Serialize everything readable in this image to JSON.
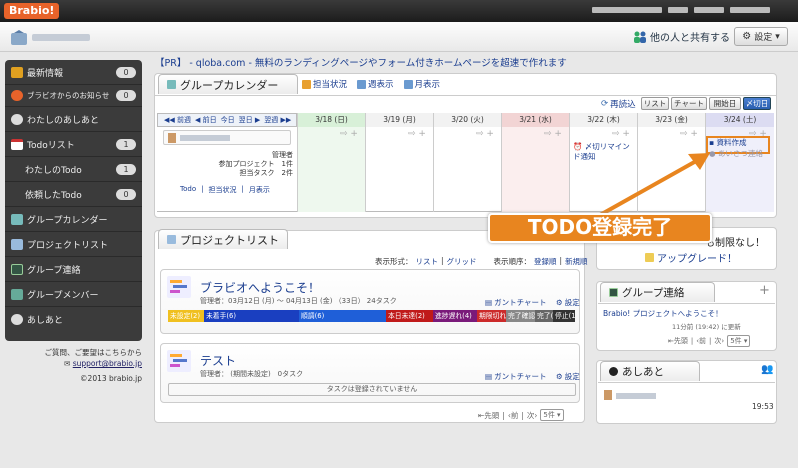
{
  "app": {
    "logo": "Brabio!"
  },
  "header": {
    "share_label": "他の人と共有する",
    "settings_label": "設定"
  },
  "sidebar": {
    "items": [
      {
        "label": "最新情報",
        "count": "0"
      },
      {
        "label": "ブラビオからのお知らせ",
        "count": "0"
      },
      {
        "label": "わたしのあしあと"
      },
      {
        "label": "Todoリスト",
        "count": "1"
      },
      {
        "label": "わたしのTodo",
        "count": "1"
      },
      {
        "label": "依頼したTodo",
        "count": "0"
      },
      {
        "label": "グループカレンダー"
      },
      {
        "label": "プロジェクトリスト"
      },
      {
        "label": "グループ連絡"
      },
      {
        "label": "グループメンバー"
      },
      {
        "label": "あしあと"
      }
    ],
    "footer": {
      "line1": "ご質問、ご要望はこちらから",
      "email": "support@brabio.jp",
      "copyright": "©2013 brabio.jp"
    }
  },
  "pr_text": "【PR】 - qloba.com - 無料のランディングページやフォーム付きホームページを超速で作れます",
  "calendar": {
    "tab": "グループカレンダー",
    "links": [
      "担当状況",
      "週表示",
      "月表示"
    ],
    "reload": "再読込",
    "view_buttons": [
      "リスト",
      "チャート",
      "開始日",
      "〆切日"
    ],
    "nav": [
      "◀◀ 前週",
      "◀ 前日",
      "今日",
      "翌日 ▶",
      "翌週 ▶▶"
    ],
    "dates": [
      "3/18 (日)",
      "3/19 (月)",
      "3/20 (火)",
      "3/21 (水)",
      "3/22 (木)",
      "3/23 (金)",
      "3/24 (土)"
    ],
    "user_labels": [
      "管理者",
      "参加プロジェクト",
      "担当タスク"
    ],
    "user_values": [
      "",
      "1件",
      "2件"
    ],
    "user_links": [
      "Todo",
      "担当状況",
      "月表示"
    ],
    "event_thu": "〆切リマインド通知",
    "event_sat": [
      "資料作成",
      "あいさつ連絡"
    ]
  },
  "callout": "TODO登録完了",
  "projects": {
    "tab": "プロジェクトリスト",
    "display_label": "表示形式：",
    "display_options": [
      "リスト",
      "グリッド"
    ],
    "order_label": "表示順序：",
    "order_options": [
      "登録順",
      "新規順"
    ],
    "items": [
      {
        "title": "ブラビオへようこそ！",
        "meta": "管理者：03月12日 (月) 〜 04月13日 (金) （33日） 24タスク",
        "gantt": "ガントチャート",
        "settings": "設定"
      },
      {
        "title": "テスト",
        "meta": "管理者： (期間未設定)　0タスク",
        "gantt": "ガントチャート",
        "settings": "設定",
        "empty": "タスクは登録されていません"
      }
    ],
    "status": [
      {
        "label": "未設定(2)",
        "color": "#f0c020",
        "w": 10
      },
      {
        "label": "未着手(6)",
        "color": "#1a3fc0",
        "w": 26
      },
      {
        "label": "順調(6)",
        "color": "#1f5fd8",
        "w": 24
      },
      {
        "label": "本日未達(2)",
        "color": "#c01a1a",
        "w": 13
      },
      {
        "label": "進捗遅れ(4)",
        "color": "#7a1a7a",
        "w": 12
      },
      {
        "label": "期限切れ(1)",
        "color": "#cc2a2a",
        "w": 8
      },
      {
        "label": "完了確認(1)",
        "color": "#888888",
        "w": 8
      },
      {
        "label": "完了(1)",
        "color": "#666666",
        "w": 5
      },
      {
        "label": "停止(1)",
        "color": "#333333",
        "w": 6
      }
    ],
    "pager": [
      "先頭",
      "前",
      "次"
    ],
    "per_page": "5件"
  },
  "upgrade": {
    "line1": "も制限なし！",
    "line2": "アップグレード！"
  },
  "group_contact": {
    "title": "グループ連絡",
    "plus": "+",
    "message": "Brabio! プロジェクトへようこそ！",
    "time": "11分前 (19:42) に更新",
    "pager": [
      "先頭",
      "前",
      "次"
    ],
    "per_page": "5件"
  },
  "ashiato": {
    "title": "あしあと",
    "time": "19:53"
  }
}
